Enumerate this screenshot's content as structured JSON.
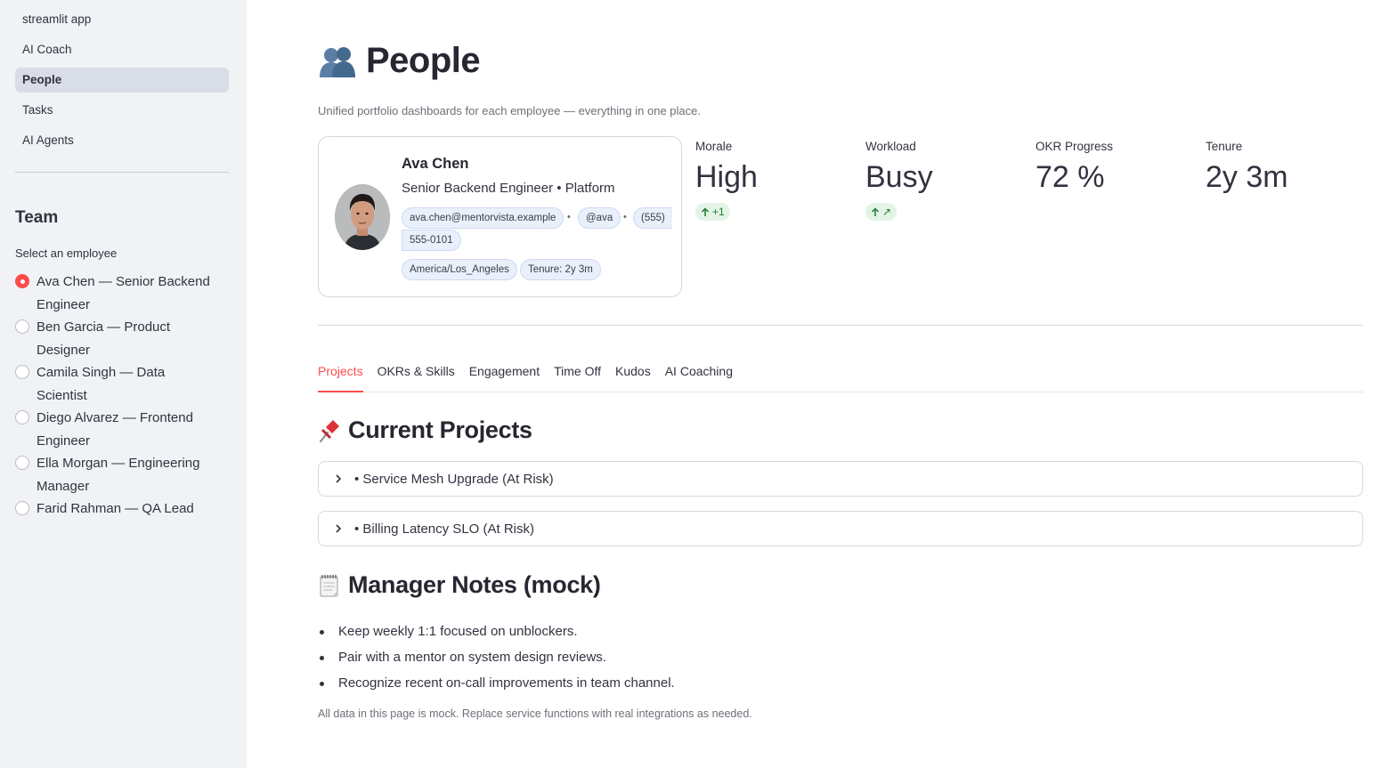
{
  "sidebar": {
    "nav": [
      {
        "label": "streamlit app",
        "active": false
      },
      {
        "label": "AI Coach",
        "active": false
      },
      {
        "label": "People",
        "active": true
      },
      {
        "label": "Tasks",
        "active": false
      },
      {
        "label": "AI Agents",
        "active": false
      }
    ],
    "team_title": "Team",
    "select_label": "Select an employee",
    "employees": [
      {
        "label": "Ava Chen — Senior Backend Engineer",
        "selected": true
      },
      {
        "label": "Ben Garcia — Product Designer",
        "selected": false
      },
      {
        "label": "Camila Singh — Data Scientist",
        "selected": false
      },
      {
        "label": "Diego Alvarez — Frontend Engineer",
        "selected": false
      },
      {
        "label": "Ella Morgan — Engineering Manager",
        "selected": false
      },
      {
        "label": "Farid Rahman — QA Lead",
        "selected": false
      }
    ]
  },
  "page": {
    "title": "People",
    "title_icon": "busts-in-silhouette-icon",
    "subtitle": "Unified portfolio dashboards for each employee — everything in one place."
  },
  "profile": {
    "name": "Ava Chen",
    "role": "Senior Backend Engineer • Platform",
    "email": "ava.chen@mentorvista.example",
    "handle": "@ava",
    "phone_part1": "(555)",
    "phone_part2": "555-0101",
    "separator": "•",
    "timezone": "America/Los_Angeles",
    "tenure_chip": "Tenure: 2y 3m"
  },
  "metrics": [
    {
      "label": "Morale",
      "value": "High",
      "delta": "+1"
    },
    {
      "label": "Workload",
      "value": "Busy",
      "delta": "↗"
    },
    {
      "label": "OKR Progress",
      "value": "72 %",
      "delta": null
    },
    {
      "label": "Tenure",
      "value": "2y 3m",
      "delta": null
    }
  ],
  "tabs": [
    {
      "label": "Projects",
      "active": true
    },
    {
      "label": "OKRs & Skills",
      "active": false
    },
    {
      "label": "Engagement",
      "active": false
    },
    {
      "label": "Time Off",
      "active": false
    },
    {
      "label": "Kudos",
      "active": false
    },
    {
      "label": "AI Coaching",
      "active": false
    }
  ],
  "projects": {
    "heading": "Current Projects",
    "icon": "pushpin-icon",
    "items": [
      {
        "label": "• Service Mesh Upgrade (At Risk)"
      },
      {
        "label": "• Billing Latency SLO (At Risk)"
      }
    ]
  },
  "notes": {
    "heading": "Manager Notes (mock)",
    "icon": "notepad-icon",
    "items": [
      "Keep weekly 1:1 focused on unblockers.",
      "Pair with a mentor on system design reviews.",
      "Recognize recent on-call improvements in team channel."
    ]
  },
  "footnote": "All data in this page is mock. Replace service functions with real integrations as needed.",
  "colors": {
    "accent": "#ff4b4b",
    "sidebar_bg": "#f0f2f6",
    "chip_bg": "#eaf0fb",
    "delta_bg": "#e3f4e6",
    "delta_fg": "#1f7a34"
  }
}
